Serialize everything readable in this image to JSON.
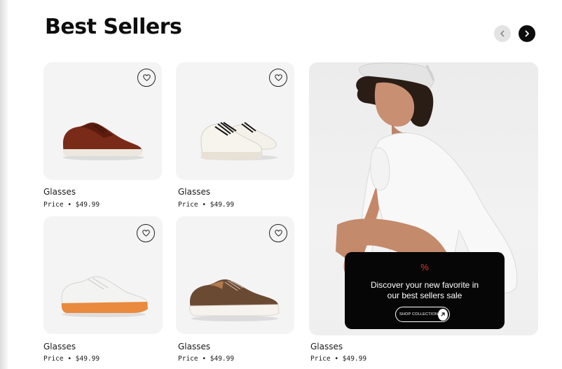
{
  "section": {
    "title": "Best Sellers"
  },
  "products": [
    {
      "name": "Glasses",
      "price": "Price • $49.99"
    },
    {
      "name": "Glasses",
      "price": "Price • $49.99"
    },
    {
      "name": "Glasses",
      "price": "Price • $49.99"
    },
    {
      "name": "Glasses",
      "price": "Price • $49.99"
    },
    {
      "name": "Glasses",
      "price": "Price • $49.99"
    }
  ],
  "promo": {
    "symbol": "%",
    "line1": "Discover your new favorite in",
    "line2": "our best sellers sale",
    "cta": "SHOP COLLECTION"
  },
  "colors": {
    "accent": "#e23a2a",
    "dark": "#0d0d0d",
    "card_bg": "#f4f4f4"
  },
  "icons": [
    "chevron-left-icon",
    "chevron-right-icon",
    "heart-icon",
    "arrow-up-right-icon"
  ]
}
